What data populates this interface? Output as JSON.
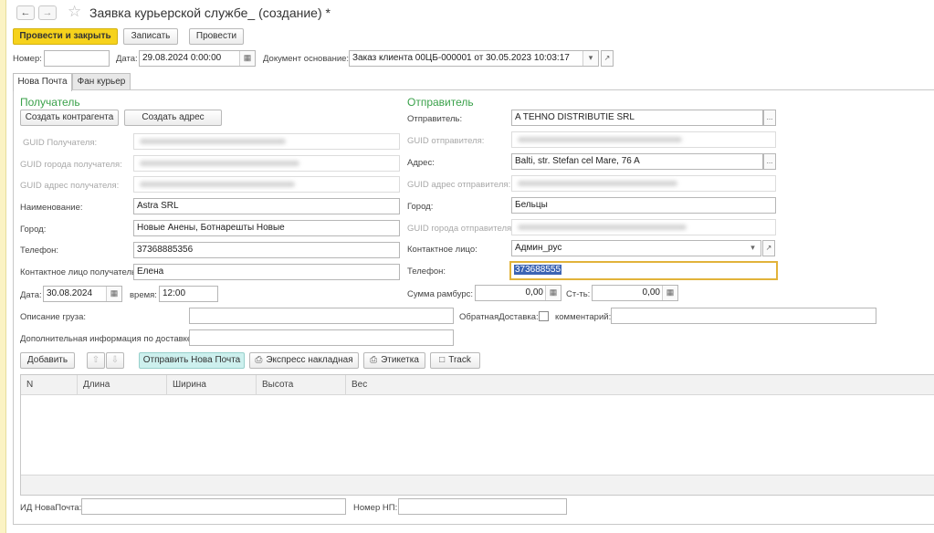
{
  "window": {
    "title": "Заявка курьерской службе_ (создание) *"
  },
  "toolbar": {
    "post_close": "Провести и закрыть",
    "save": "Записать",
    "post": "Провести",
    "back_icon": "arrow-left-icon",
    "forward_icon": "arrow-right-icon",
    "favorite_icon": "star-icon"
  },
  "header": {
    "number_label": "Номер:",
    "number_value": "",
    "date_label": "Дата:",
    "date_value": "29.08.2024  0:00:00",
    "basis_label": "Документ основание:",
    "basis_value": "Заказ клиента 00ЦБ-000001 от 30.05.2023 10:03:17"
  },
  "tabs": [
    {
      "label": "Нова Почта",
      "active": true
    },
    {
      "label": "Фан курьер",
      "active": false
    }
  ],
  "recipient": {
    "section_title": "Получатель",
    "create_contractor": "Создать контрагента",
    "create_address": "Создать адрес",
    "guid_label": "GUID Получателя:",
    "guid_city_label": "GUID города получателя:",
    "guid_address_label": "GUID адрес получателя:",
    "name_label": "Наименование:",
    "name_value": "Astra SRL",
    "city_label": "Город:",
    "city_value": "Новые Анены, Ботнарешты Новые",
    "phone_label": "Телефон:",
    "phone_value": "37368885356",
    "contact_label": "Контактное лицо получатель:",
    "contact_value": "Елена",
    "date_label": "Дата:",
    "date_value": "30.08.2024",
    "time_label": "время:",
    "time_value": "12:00"
  },
  "sender": {
    "section_title": "Отправитель",
    "sender_label": "Отправитель:",
    "sender_value": "A TEHNO DISTRIBUTIE SRL",
    "guid_label": "GUID отправителя:",
    "address_label": "Адрес:",
    "address_value": "Balti, str. Stefan cel Mare, 76 A",
    "guid_address_label": "GUID адрес отправителя:",
    "city_label": "Город:",
    "city_value": "Бельцы",
    "guid_city_label": "GUID города отправителя:",
    "contact_label": "Контактное лицо:",
    "contact_value": "Админ_рус",
    "phone_label": "Телефон:",
    "phone_value": "373688555",
    "cod_label": "Сумма рамбурс:",
    "cod_value": "0,00",
    "cost_label": "Ст-ть:",
    "cost_value": "0,00"
  },
  "cargo": {
    "description_label": "Описание груза:",
    "description_value": "",
    "return_label": "ОбратнаяДоставка:",
    "return_checked": false,
    "comment_label": "комментарий:",
    "comment_value": "",
    "extra_label": "Дополнительная информация по доставке:",
    "extra_value": ""
  },
  "actions": {
    "add": "Добавить",
    "send_nova": "Отправить Нова Почта",
    "express_waybill": "Экспресс накладная",
    "label": "Этикетка",
    "track": "Track"
  },
  "table": {
    "columns": [
      "N",
      "Длина",
      "Ширина",
      "Высота",
      "Вес"
    ],
    "rows": []
  },
  "footer": {
    "nova_id_label": "ИД НоваПочта:",
    "nova_id_value": "",
    "np_number_label": "Номер НП:",
    "np_number_value": ""
  },
  "colors": {
    "accent_yellow": "#f6d21c",
    "section_green": "#3aa14a",
    "nova_button": "#cdf0ee",
    "focus_border": "#e2b33a",
    "selection": "#3c64b4"
  }
}
